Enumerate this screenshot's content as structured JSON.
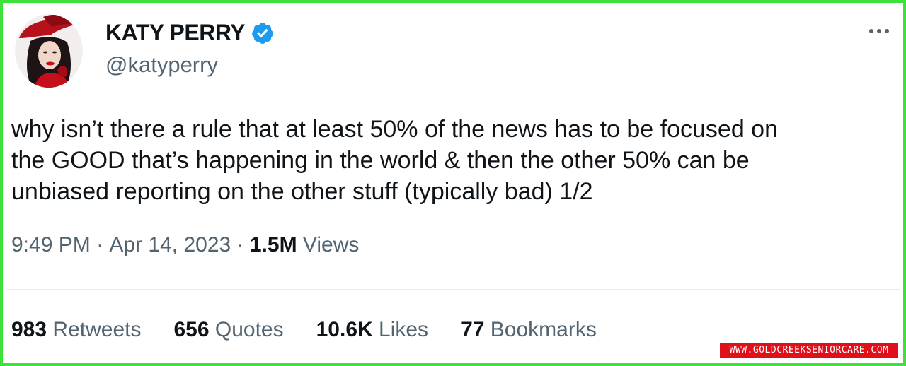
{
  "tweet": {
    "display_name": "KATY PERRY",
    "handle": "@katyperry",
    "verified": true,
    "text": "why isn’t there a rule that at least 50% of the news has to be focused on\nthe GOOD that’s happening in the world & then the other 50% can be\nunbiased reporting on the other stuff (typically bad) 1/2",
    "time": "9:49 PM",
    "date": "Apr 14, 2023",
    "views_count": "1.5M",
    "views_label": "Views"
  },
  "stats": {
    "retweets_count": "983",
    "retweets_label": "Retweets",
    "quotes_count": "656",
    "quotes_label": "Quotes",
    "likes_count": "10.6K",
    "likes_label": "Likes",
    "bookmarks_count": "77",
    "bookmarks_label": "Bookmarks"
  },
  "watermark": "WWW.GOLDCREEKSENIORCARE.COM",
  "colors": {
    "border": "#3ee03a",
    "verified": "#1d9bf0",
    "secondary_text": "#536471",
    "watermark_bg": "#e0101a"
  },
  "icons": [
    "avatar",
    "verified-badge-icon",
    "more-options-icon"
  ]
}
